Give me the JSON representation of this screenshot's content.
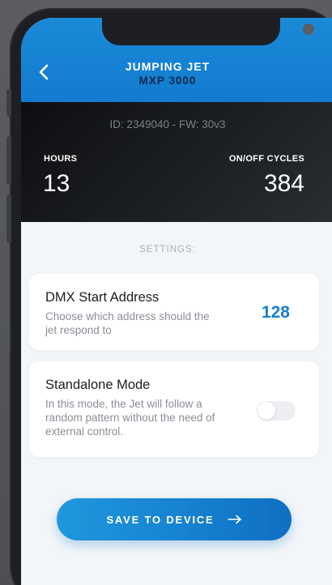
{
  "header": {
    "title_line1": "JUMPING JET",
    "title_line2": "MXP 3000",
    "back_icon": "chevron-left-icon"
  },
  "device": {
    "id_line": "ID: 2349040 - FW: 30v3"
  },
  "stats": {
    "hours_label": "HOURS",
    "hours_value": "13",
    "cycles_label": "ON/OFF CYCLES",
    "cycles_value": "384"
  },
  "settings": {
    "section_label": "SETTINGS:",
    "dmx": {
      "title": "DMX Start Address",
      "description": "Choose which address should the jet respond to",
      "value": "128"
    },
    "standalone": {
      "title": "Standalone Mode",
      "description": "In this mode, the Jet will follow a random pattern without the need of external control.",
      "enabled": false
    }
  },
  "actions": {
    "save_label": "SAVE TO DEVICE",
    "save_icon": "arrow-right-icon"
  },
  "colors": {
    "accent": "#1480cf",
    "header_blue": "#1b8ad7",
    "dark_panel": "#1e2124"
  }
}
